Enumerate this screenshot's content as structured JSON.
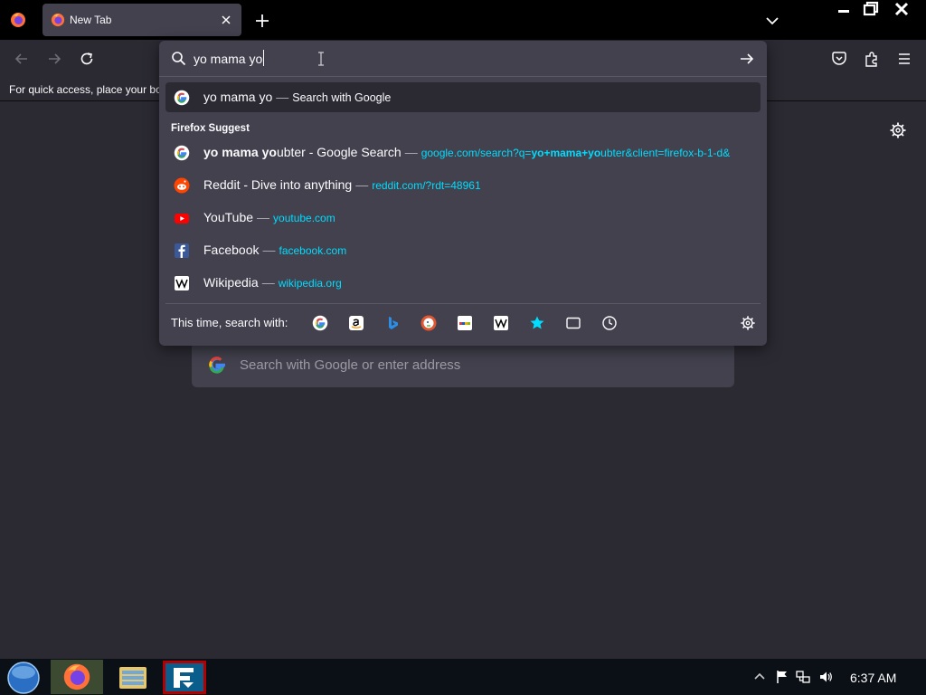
{
  "tab": {
    "title": "New Tab",
    "icon": "firefox-icon"
  },
  "toolbar": {
    "back": "back-arrow-icon",
    "forward": "forward-arrow-icon",
    "reload": "reload-icon",
    "pocket": "pocket-icon",
    "extensions": "extensions-icon",
    "menu": "hamburger-menu-icon"
  },
  "bookmarks_bar": {
    "hint": "For quick access, place your bookmarks here on the bookmarks toolbar."
  },
  "urlbar": {
    "value": "yo mama yo",
    "heuristic": {
      "query": "yo mama yo",
      "action": "Search with Google"
    },
    "group_label": "Firefox Suggest",
    "results": [
      {
        "bold": "yo mama yo",
        "title_rest": "ubter - Google Search",
        "url_prefix": "google.com/search?q=",
        "url_bold": "yo+mama+yo",
        "url_rest": "ubter&client=firefox-b-1-d&",
        "icon": "google-icon"
      },
      {
        "title": "Reddit - Dive into anything",
        "url": "reddit.com/?rdt=48961",
        "icon": "reddit-icon"
      },
      {
        "title": "YouTube",
        "url": "youtube.com",
        "icon": "youtube-icon"
      },
      {
        "title": "Facebook",
        "url": "facebook.com",
        "icon": "facebook-icon"
      },
      {
        "title": "Wikipedia",
        "url": "wikipedia.org",
        "icon": "wikipedia-icon"
      }
    ],
    "separator": "—",
    "oneoff_label": "This time, search with:",
    "oneoffs": [
      "google-icon",
      "amazon-icon",
      "bing-icon",
      "duckduckgo-icon",
      "ebay-icon",
      "wikipedia-icon",
      "bookmarks-star-icon",
      "tabs-icon",
      "history-icon"
    ]
  },
  "newtab": {
    "search_placeholder": "Search with Google or enter address"
  },
  "taskbar": {
    "apps": [
      "firefox-icon",
      "file-explorer-icon",
      "filezilla-icon"
    ],
    "clock": "6:37 AM"
  },
  "colors": {
    "accent_url": "#00ddff",
    "panel": "#42414d",
    "toolbar": "#2b2a33",
    "tabstrip": "#000000"
  }
}
